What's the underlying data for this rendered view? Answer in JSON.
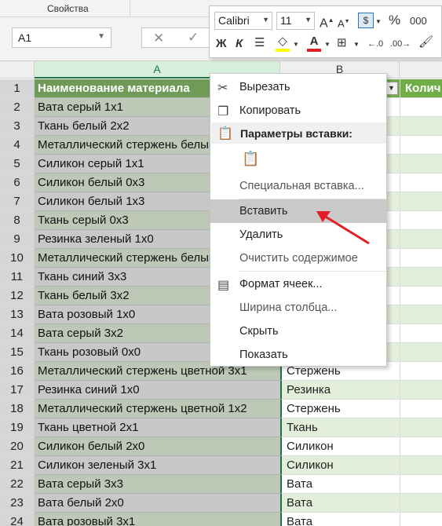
{
  "ribbon": {
    "group_label": "Свойства"
  },
  "formula_bar": {
    "name_box": "A1"
  },
  "columns": [
    {
      "letter": "A"
    },
    {
      "letter": "B"
    }
  ],
  "header_row": {
    "row_number": "1",
    "a": "Наименование материала",
    "c": "Колич"
  },
  "rows": [
    {
      "n": "2",
      "a": "Вата серый 1х1",
      "b": ""
    },
    {
      "n": "3",
      "a": "Ткань белый 2х2",
      "b": ""
    },
    {
      "n": "4",
      "a": "Металлический стержень белый",
      "b": ""
    },
    {
      "n": "5",
      "a": "Силикон серый 1х1",
      "b": ""
    },
    {
      "n": "6",
      "a": "Силикон белый 0х3",
      "b": ""
    },
    {
      "n": "7",
      "a": "Силикон белый 1х3",
      "b": ""
    },
    {
      "n": "8",
      "a": "Ткань серый 0х3",
      "b": ""
    },
    {
      "n": "9",
      "a": "Резинка зеленый 1х0",
      "b": ""
    },
    {
      "n": "10",
      "a": "Металлический стержень белый",
      "b": ""
    },
    {
      "n": "11",
      "a": "Ткань синий 3х3",
      "b": ""
    },
    {
      "n": "12",
      "a": "Ткань белый 3х2",
      "b": ""
    },
    {
      "n": "13",
      "a": "Вата розовый 1х0",
      "b": ""
    },
    {
      "n": "14",
      "a": "Вата серый 3х2",
      "b": ""
    },
    {
      "n": "15",
      "a": "Ткань розовый 0х0",
      "b": ""
    },
    {
      "n": "16",
      "a": "Металлический стержень цветной 3х1",
      "b": "Стержень"
    },
    {
      "n": "17",
      "a": "Резинка синий 1х0",
      "b": "Резинка"
    },
    {
      "n": "18",
      "a": "Металлический стержень цветной 1х2",
      "b": "Стержень"
    },
    {
      "n": "19",
      "a": "Ткань цветной 2х1",
      "b": "Ткань"
    },
    {
      "n": "20",
      "a": "Силикон белый 2х0",
      "b": "Силикон"
    },
    {
      "n": "21",
      "a": "Силикон зеленый 3х1",
      "b": "Силикон"
    },
    {
      "n": "22",
      "a": "Вата серый 3х3",
      "b": "Вата"
    },
    {
      "n": "23",
      "a": "Вата белый 2х0",
      "b": "Вата"
    },
    {
      "n": "24",
      "a": "Вата розовый 3х1",
      "b": "Вата"
    }
  ],
  "mini_toolbar": {
    "font_name": "Calibri",
    "font_size": "11",
    "bold": "Ж",
    "italic": "К",
    "percent": "%",
    "thousands": "000"
  },
  "context_menu": {
    "cut": "Вырезать",
    "copy": "Копировать",
    "paste_options_header": "Параметры вставки:",
    "paste_special": "Специальная вставка...",
    "insert": "Вставить",
    "delete": "Удалить",
    "clear_contents": "Очистить содержимое",
    "format_cells": "Формат ячеек...",
    "column_width": "Ширина столбца...",
    "hide": "Скрыть",
    "unhide": "Показать"
  },
  "colors": {
    "header_green": "#6f9a58",
    "selection_green": "#217346",
    "band_green": "#e3efda",
    "annotation_red": "#e31e24"
  }
}
